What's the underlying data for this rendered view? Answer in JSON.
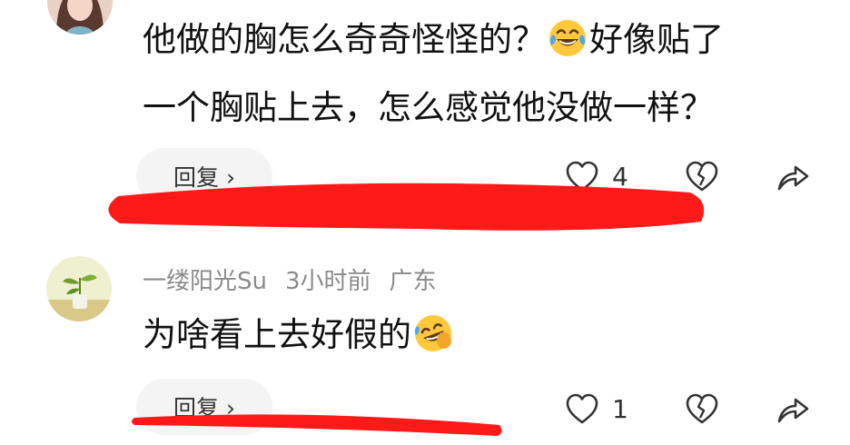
{
  "comments": [
    {
      "text_line1_a": "他做的胸怎么奇奇怪怪的？",
      "text_line1_b": "好像贴了",
      "text_line2": "一个胸贴上去，怎么感觉他没做一样？",
      "emoji_icon": "tears-of-joy-emoji",
      "reply_label": "回复 ›",
      "like_count": "4"
    },
    {
      "username": "一缕阳光Su",
      "time": "3小时前",
      "location": "广东",
      "text": "为啥看上去好假的",
      "emoji_icon": "rolling-on-floor-laughing-emoji",
      "reply_label": "回复 ›",
      "like_count": "1"
    }
  ],
  "colors": {
    "text": "#111111",
    "meta": "#8a8a8a",
    "marker_red": "#ff1a1a",
    "emoji_yellow": "#ffc83d",
    "reply_bg": "#f4f4f4"
  },
  "icons": [
    "heart-outline-icon",
    "broken-heart-icon",
    "share-arrow-icon"
  ]
}
